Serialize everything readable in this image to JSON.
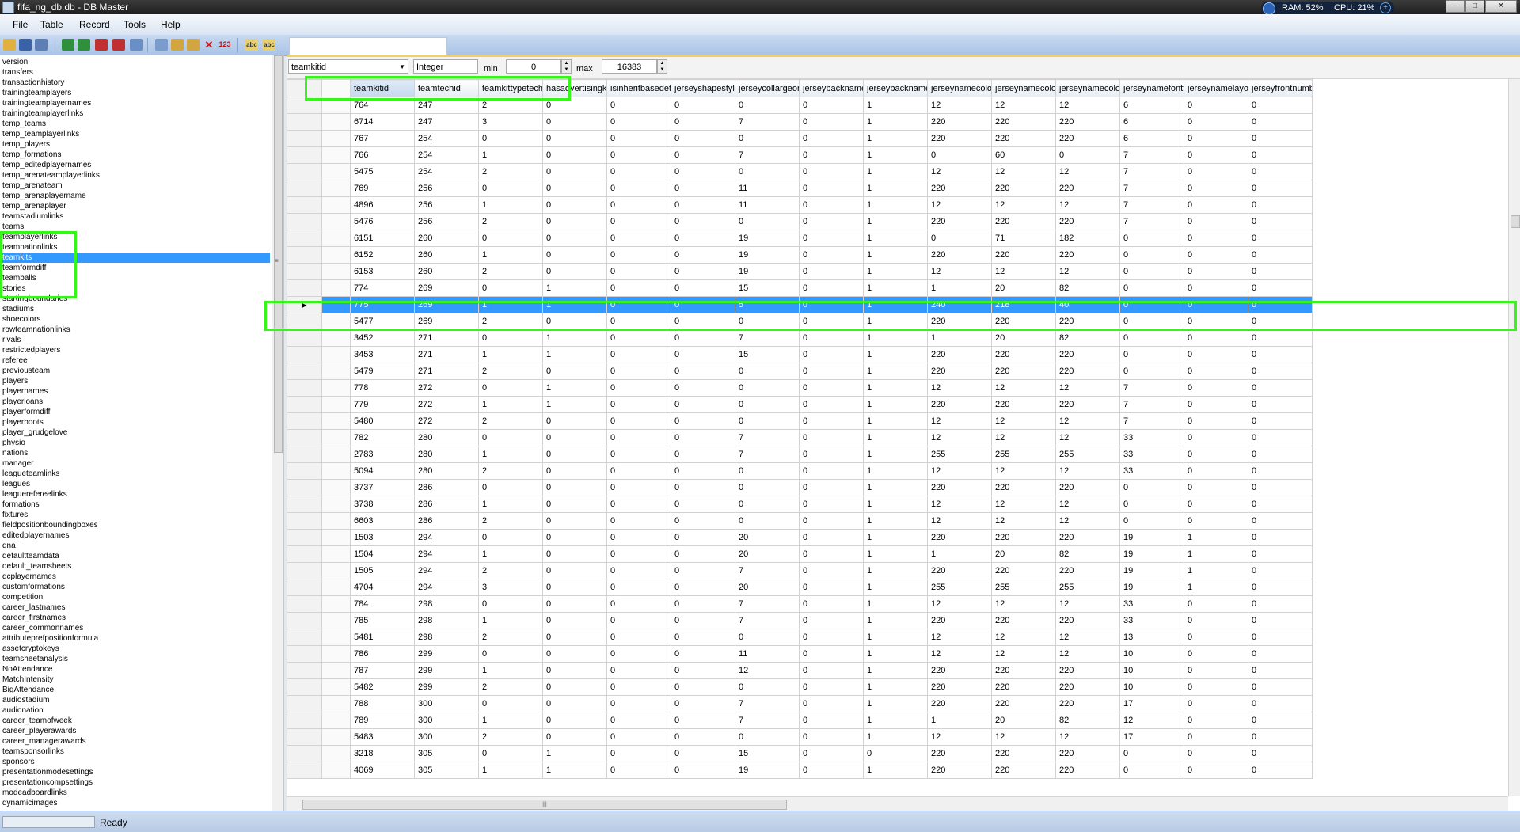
{
  "window": {
    "title": "fifa_ng_db.db - DB Master",
    "ram": "RAM: 52%",
    "cpu": "CPU: 21%"
  },
  "menu": [
    "File",
    "Table",
    "Record",
    "Tools",
    "Help"
  ],
  "tables": [
    "version",
    "transfers",
    "transactionhistory",
    "trainingteamplayers",
    "trainingteamplayernames",
    "trainingteamplayerlinks",
    "temp_teams",
    "temp_teamplayerlinks",
    "temp_players",
    "temp_formations",
    "temp_editedplayernames",
    "temp_arenateamplayerlinks",
    "temp_arenateam",
    "temp_arenaplayername",
    "temp_arenaplayer",
    "teamstadiumlinks",
    "teams",
    "teamplayerlinks",
    "teamnationlinks",
    "teamkits",
    "teamformdiff",
    "teamballs",
    "stories",
    "startingboundaries",
    "stadiums",
    "shoecolors",
    "rowteamnationlinks",
    "rivals",
    "restrictedplayers",
    "referee",
    "previousteam",
    "players",
    "playernames",
    "playerloans",
    "playerformdiff",
    "playerboots",
    "player_grudgelove",
    "physio",
    "nations",
    "manager",
    "leagueteamlinks",
    "leagues",
    "leaguerefereelinks",
    "formations",
    "fixtures",
    "fieldpositionboundingboxes",
    "editedplayernames",
    "dna",
    "defaultteamdata",
    "default_teamsheets",
    "dcplayernames",
    "customformations",
    "competition",
    "career_lastnames",
    "career_firstnames",
    "career_commonnames",
    "attributeprefpositionformula",
    "assetcryptokeys",
    "teamsheetanalysis",
    "NoAttendance",
    "MatchIntensity",
    "BigAttendance",
    "audiostadium",
    "audionation",
    "career_teamofweek",
    "career_playerawards",
    "career_managerawards",
    "teamsponsorlinks",
    "sponsors",
    "presentationmodesettings",
    "presentationcompsettings",
    "modeadboardlinks",
    "dynamicimages"
  ],
  "selected_table": "teamkits",
  "field": {
    "name": "teamkitid",
    "type": "Integer",
    "min_label": "min",
    "min": "0",
    "max_label": "max",
    "max": "16383"
  },
  "columns": [
    "teamkitid",
    "teamtechid",
    "teamkittypetechid",
    "hasadvertisingkit",
    "isinheritbasedetailm",
    "jerseyshapestyle",
    "jerseycollargeometr",
    "jerseybacknamefon",
    "jerseybacknamepla",
    "jerseynamecolorr",
    "jerseynamecolorg",
    "jerseynamecolorb",
    "jerseynamefonttype",
    "jerseynamelayouttyp",
    "jerseyfrontnumberpl"
  ],
  "rows": [
    [
      "764",
      "247",
      "2",
      "0",
      "0",
      "0",
      "0",
      "0",
      "1",
      "12",
      "12",
      "12",
      "6",
      "0",
      "0"
    ],
    [
      "6714",
      "247",
      "3",
      "0",
      "0",
      "0",
      "7",
      "0",
      "1",
      "220",
      "220",
      "220",
      "6",
      "0",
      "0"
    ],
    [
      "767",
      "254",
      "0",
      "0",
      "0",
      "0",
      "0",
      "0",
      "1",
      "220",
      "220",
      "220",
      "6",
      "0",
      "0"
    ],
    [
      "766",
      "254",
      "1",
      "0",
      "0",
      "0",
      "7",
      "0",
      "1",
      "0",
      "60",
      "0",
      "7",
      "0",
      "0"
    ],
    [
      "5475",
      "254",
      "2",
      "0",
      "0",
      "0",
      "0",
      "0",
      "1",
      "12",
      "12",
      "12",
      "7",
      "0",
      "0"
    ],
    [
      "769",
      "256",
      "0",
      "0",
      "0",
      "0",
      "11",
      "0",
      "1",
      "220",
      "220",
      "220",
      "7",
      "0",
      "0"
    ],
    [
      "4896",
      "256",
      "1",
      "0",
      "0",
      "0",
      "11",
      "0",
      "1",
      "12",
      "12",
      "12",
      "7",
      "0",
      "0"
    ],
    [
      "5476",
      "256",
      "2",
      "0",
      "0",
      "0",
      "0",
      "0",
      "1",
      "220",
      "220",
      "220",
      "7",
      "0",
      "0"
    ],
    [
      "6151",
      "260",
      "0",
      "0",
      "0",
      "0",
      "19",
      "0",
      "1",
      "0",
      "71",
      "182",
      "0",
      "0",
      "0"
    ],
    [
      "6152",
      "260",
      "1",
      "0",
      "0",
      "0",
      "19",
      "0",
      "1",
      "220",
      "220",
      "220",
      "0",
      "0",
      "0"
    ],
    [
      "6153",
      "260",
      "2",
      "0",
      "0",
      "0",
      "19",
      "0",
      "1",
      "12",
      "12",
      "12",
      "0",
      "0",
      "0"
    ],
    [
      "774",
      "269",
      "0",
      "1",
      "0",
      "0",
      "15",
      "0",
      "1",
      "1",
      "20",
      "82",
      "0",
      "0",
      "0"
    ],
    [
      "775",
      "269",
      "1",
      "1",
      "0",
      "0",
      "5",
      "0",
      "1",
      "240",
      "218",
      "40",
      "0",
      "0",
      "0"
    ],
    [
      "5477",
      "269",
      "2",
      "0",
      "0",
      "0",
      "0",
      "0",
      "1",
      "220",
      "220",
      "220",
      "0",
      "0",
      "0"
    ],
    [
      "3452",
      "271",
      "0",
      "1",
      "0",
      "0",
      "7",
      "0",
      "1",
      "1",
      "20",
      "82",
      "0",
      "0",
      "0"
    ],
    [
      "3453",
      "271",
      "1",
      "1",
      "0",
      "0",
      "15",
      "0",
      "1",
      "220",
      "220",
      "220",
      "0",
      "0",
      "0"
    ],
    [
      "5479",
      "271",
      "2",
      "0",
      "0",
      "0",
      "0",
      "0",
      "1",
      "220",
      "220",
      "220",
      "0",
      "0",
      "0"
    ],
    [
      "778",
      "272",
      "0",
      "1",
      "0",
      "0",
      "0",
      "0",
      "1",
      "12",
      "12",
      "12",
      "7",
      "0",
      "0"
    ],
    [
      "779",
      "272",
      "1",
      "1",
      "0",
      "0",
      "0",
      "0",
      "1",
      "220",
      "220",
      "220",
      "7",
      "0",
      "0"
    ],
    [
      "5480",
      "272",
      "2",
      "0",
      "0",
      "0",
      "0",
      "0",
      "1",
      "12",
      "12",
      "12",
      "7",
      "0",
      "0"
    ],
    [
      "782",
      "280",
      "0",
      "0",
      "0",
      "0",
      "7",
      "0",
      "1",
      "12",
      "12",
      "12",
      "33",
      "0",
      "0"
    ],
    [
      "2783",
      "280",
      "1",
      "0",
      "0",
      "0",
      "7",
      "0",
      "1",
      "255",
      "255",
      "255",
      "33",
      "0",
      "0"
    ],
    [
      "5094",
      "280",
      "2",
      "0",
      "0",
      "0",
      "0",
      "0",
      "1",
      "12",
      "12",
      "12",
      "33",
      "0",
      "0"
    ],
    [
      "3737",
      "286",
      "0",
      "0",
      "0",
      "0",
      "0",
      "0",
      "1",
      "220",
      "220",
      "220",
      "0",
      "0",
      "0"
    ],
    [
      "3738",
      "286",
      "1",
      "0",
      "0",
      "0",
      "0",
      "0",
      "1",
      "12",
      "12",
      "12",
      "0",
      "0",
      "0"
    ],
    [
      "6603",
      "286",
      "2",
      "0",
      "0",
      "0",
      "0",
      "0",
      "1",
      "12",
      "12",
      "12",
      "0",
      "0",
      "0"
    ],
    [
      "1503",
      "294",
      "0",
      "0",
      "0",
      "0",
      "20",
      "0",
      "1",
      "220",
      "220",
      "220",
      "19",
      "1",
      "0"
    ],
    [
      "1504",
      "294",
      "1",
      "0",
      "0",
      "0",
      "20",
      "0",
      "1",
      "1",
      "20",
      "82",
      "19",
      "1",
      "0"
    ],
    [
      "1505",
      "294",
      "2",
      "0",
      "0",
      "0",
      "7",
      "0",
      "1",
      "220",
      "220",
      "220",
      "19",
      "1",
      "0"
    ],
    [
      "4704",
      "294",
      "3",
      "0",
      "0",
      "0",
      "20",
      "0",
      "1",
      "255",
      "255",
      "255",
      "19",
      "1",
      "0"
    ],
    [
      "784",
      "298",
      "0",
      "0",
      "0",
      "0",
      "7",
      "0",
      "1",
      "12",
      "12",
      "12",
      "33",
      "0",
      "0"
    ],
    [
      "785",
      "298",
      "1",
      "0",
      "0",
      "0",
      "7",
      "0",
      "1",
      "220",
      "220",
      "220",
      "33",
      "0",
      "0"
    ],
    [
      "5481",
      "298",
      "2",
      "0",
      "0",
      "0",
      "0",
      "0",
      "1",
      "12",
      "12",
      "12",
      "13",
      "0",
      "0"
    ],
    [
      "786",
      "299",
      "0",
      "0",
      "0",
      "0",
      "11",
      "0",
      "1",
      "12",
      "12",
      "12",
      "10",
      "0",
      "0"
    ],
    [
      "787",
      "299",
      "1",
      "0",
      "0",
      "0",
      "12",
      "0",
      "1",
      "220",
      "220",
      "220",
      "10",
      "0",
      "0"
    ],
    [
      "5482",
      "299",
      "2",
      "0",
      "0",
      "0",
      "0",
      "0",
      "1",
      "220",
      "220",
      "220",
      "10",
      "0",
      "0"
    ],
    [
      "788",
      "300",
      "0",
      "0",
      "0",
      "0",
      "7",
      "0",
      "1",
      "220",
      "220",
      "220",
      "17",
      "0",
      "0"
    ],
    [
      "789",
      "300",
      "1",
      "0",
      "0",
      "0",
      "7",
      "0",
      "1",
      "1",
      "20",
      "82",
      "12",
      "0",
      "0"
    ],
    [
      "5483",
      "300",
      "2",
      "0",
      "0",
      "0",
      "0",
      "0",
      "1",
      "12",
      "12",
      "12",
      "17",
      "0",
      "0"
    ],
    [
      "3218",
      "305",
      "0",
      "1",
      "0",
      "0",
      "15",
      "0",
      "0",
      "220",
      "220",
      "220",
      "0",
      "0",
      "0"
    ],
    [
      "4069",
      "305",
      "1",
      "1",
      "0",
      "0",
      "19",
      "0",
      "1",
      "220",
      "220",
      "220",
      "0",
      "0",
      "0"
    ]
  ],
  "selected_row": 12,
  "status": "Ready",
  "colors": {
    "selection": "#3399ff",
    "highlight_box": "#35f519"
  }
}
